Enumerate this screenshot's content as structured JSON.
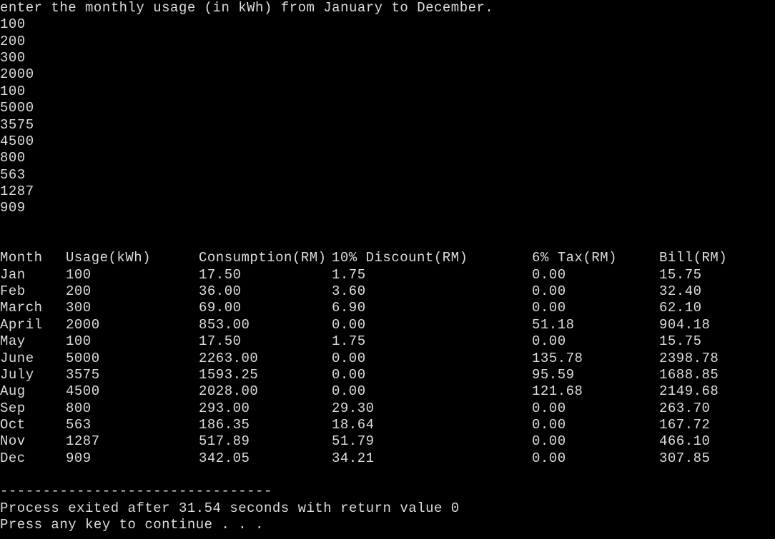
{
  "chart_data": {
    "type": "table",
    "title": "",
    "columns": [
      "Month",
      "Usage(kWh)",
      "Consumption(RM)",
      "10% Discount(RM)",
      "6% Tax(RM)",
      "Bill(RM)"
    ],
    "rows": [
      [
        "Jan",
        100,
        17.5,
        1.75,
        0.0,
        15.75
      ],
      [
        "Feb",
        200,
        36.0,
        3.6,
        0.0,
        32.4
      ],
      [
        "March",
        300,
        69.0,
        6.9,
        0.0,
        62.1
      ],
      [
        "April",
        2000,
        853.0,
        0.0,
        51.18,
        904.18
      ],
      [
        "May",
        100,
        17.5,
        1.75,
        0.0,
        15.75
      ],
      [
        "June",
        5000,
        2263.0,
        0.0,
        135.78,
        2398.78
      ],
      [
        "July",
        3575,
        1593.25,
        0.0,
        95.59,
        1688.85
      ],
      [
        "Aug",
        4500,
        2028.0,
        0.0,
        121.68,
        2149.68
      ],
      [
        "Sep",
        800,
        293.0,
        29.3,
        0.0,
        263.7
      ],
      [
        "Oct",
        563,
        186.35,
        18.64,
        0.0,
        167.72
      ],
      [
        "Nov",
        1287,
        517.89,
        51.79,
        0.0,
        466.1
      ],
      [
        "Dec",
        909,
        342.05,
        34.21,
        0.0,
        307.85
      ]
    ]
  },
  "prompt": "enter the monthly usage (in kWh) from January to December.",
  "inputs": [
    "100",
    "200",
    "300",
    "2000",
    "100",
    "5000",
    "3575",
    "4500",
    "800",
    "563",
    "1287",
    "909"
  ],
  "blank": "",
  "headers": {
    "month": "Month",
    "usage": "Usage(kWh)",
    "consumption": "Consumption(RM)",
    "discount": "10% Discount(RM)",
    "tax": "6% Tax(RM)",
    "bill": "Bill(RM)"
  },
  "rows": [
    {
      "month": "Jan",
      "usage": "100",
      "consumption": "17.50",
      "discount": "1.75",
      "tax": "0.00",
      "bill": "15.75"
    },
    {
      "month": "Feb",
      "usage": "200",
      "consumption": "36.00",
      "discount": "3.60",
      "tax": "0.00",
      "bill": "32.40"
    },
    {
      "month": "March",
      "usage": "300",
      "consumption": "69.00",
      "discount": "6.90",
      "tax": "0.00",
      "bill": "62.10"
    },
    {
      "month": "April",
      "usage": "2000",
      "consumption": "853.00",
      "discount": "0.00",
      "tax": "51.18",
      "bill": "904.18"
    },
    {
      "month": "May",
      "usage": "100",
      "consumption": "17.50",
      "discount": "1.75",
      "tax": "0.00",
      "bill": "15.75"
    },
    {
      "month": "June",
      "usage": "5000",
      "consumption": "2263.00",
      "discount": "0.00",
      "tax": "135.78",
      "bill": "2398.78"
    },
    {
      "month": "July",
      "usage": "3575",
      "consumption": "1593.25",
      "discount": "0.00",
      "tax": "95.59",
      "bill": "1688.85"
    },
    {
      "month": "Aug",
      "usage": "4500",
      "consumption": "2028.00",
      "discount": "0.00",
      "tax": "121.68",
      "bill": "2149.68"
    },
    {
      "month": "Sep",
      "usage": "800",
      "consumption": "293.00",
      "discount": "29.30",
      "tax": "0.00",
      "bill": "263.70"
    },
    {
      "month": "Oct",
      "usage": "563",
      "consumption": "186.35",
      "discount": "18.64",
      "tax": "0.00",
      "bill": "167.72"
    },
    {
      "month": "Nov",
      "usage": "1287",
      "consumption": "517.89",
      "discount": "51.79",
      "tax": "0.00",
      "bill": "466.10"
    },
    {
      "month": "Dec",
      "usage": "909",
      "consumption": "342.05",
      "discount": "34.21",
      "tax": "0.00",
      "bill": "307.85"
    }
  ],
  "divider": "--------------------------------",
  "exit_message": "Process exited after 31.54 seconds with return value 0",
  "continue_prompt": "Press any key to continue . . ."
}
